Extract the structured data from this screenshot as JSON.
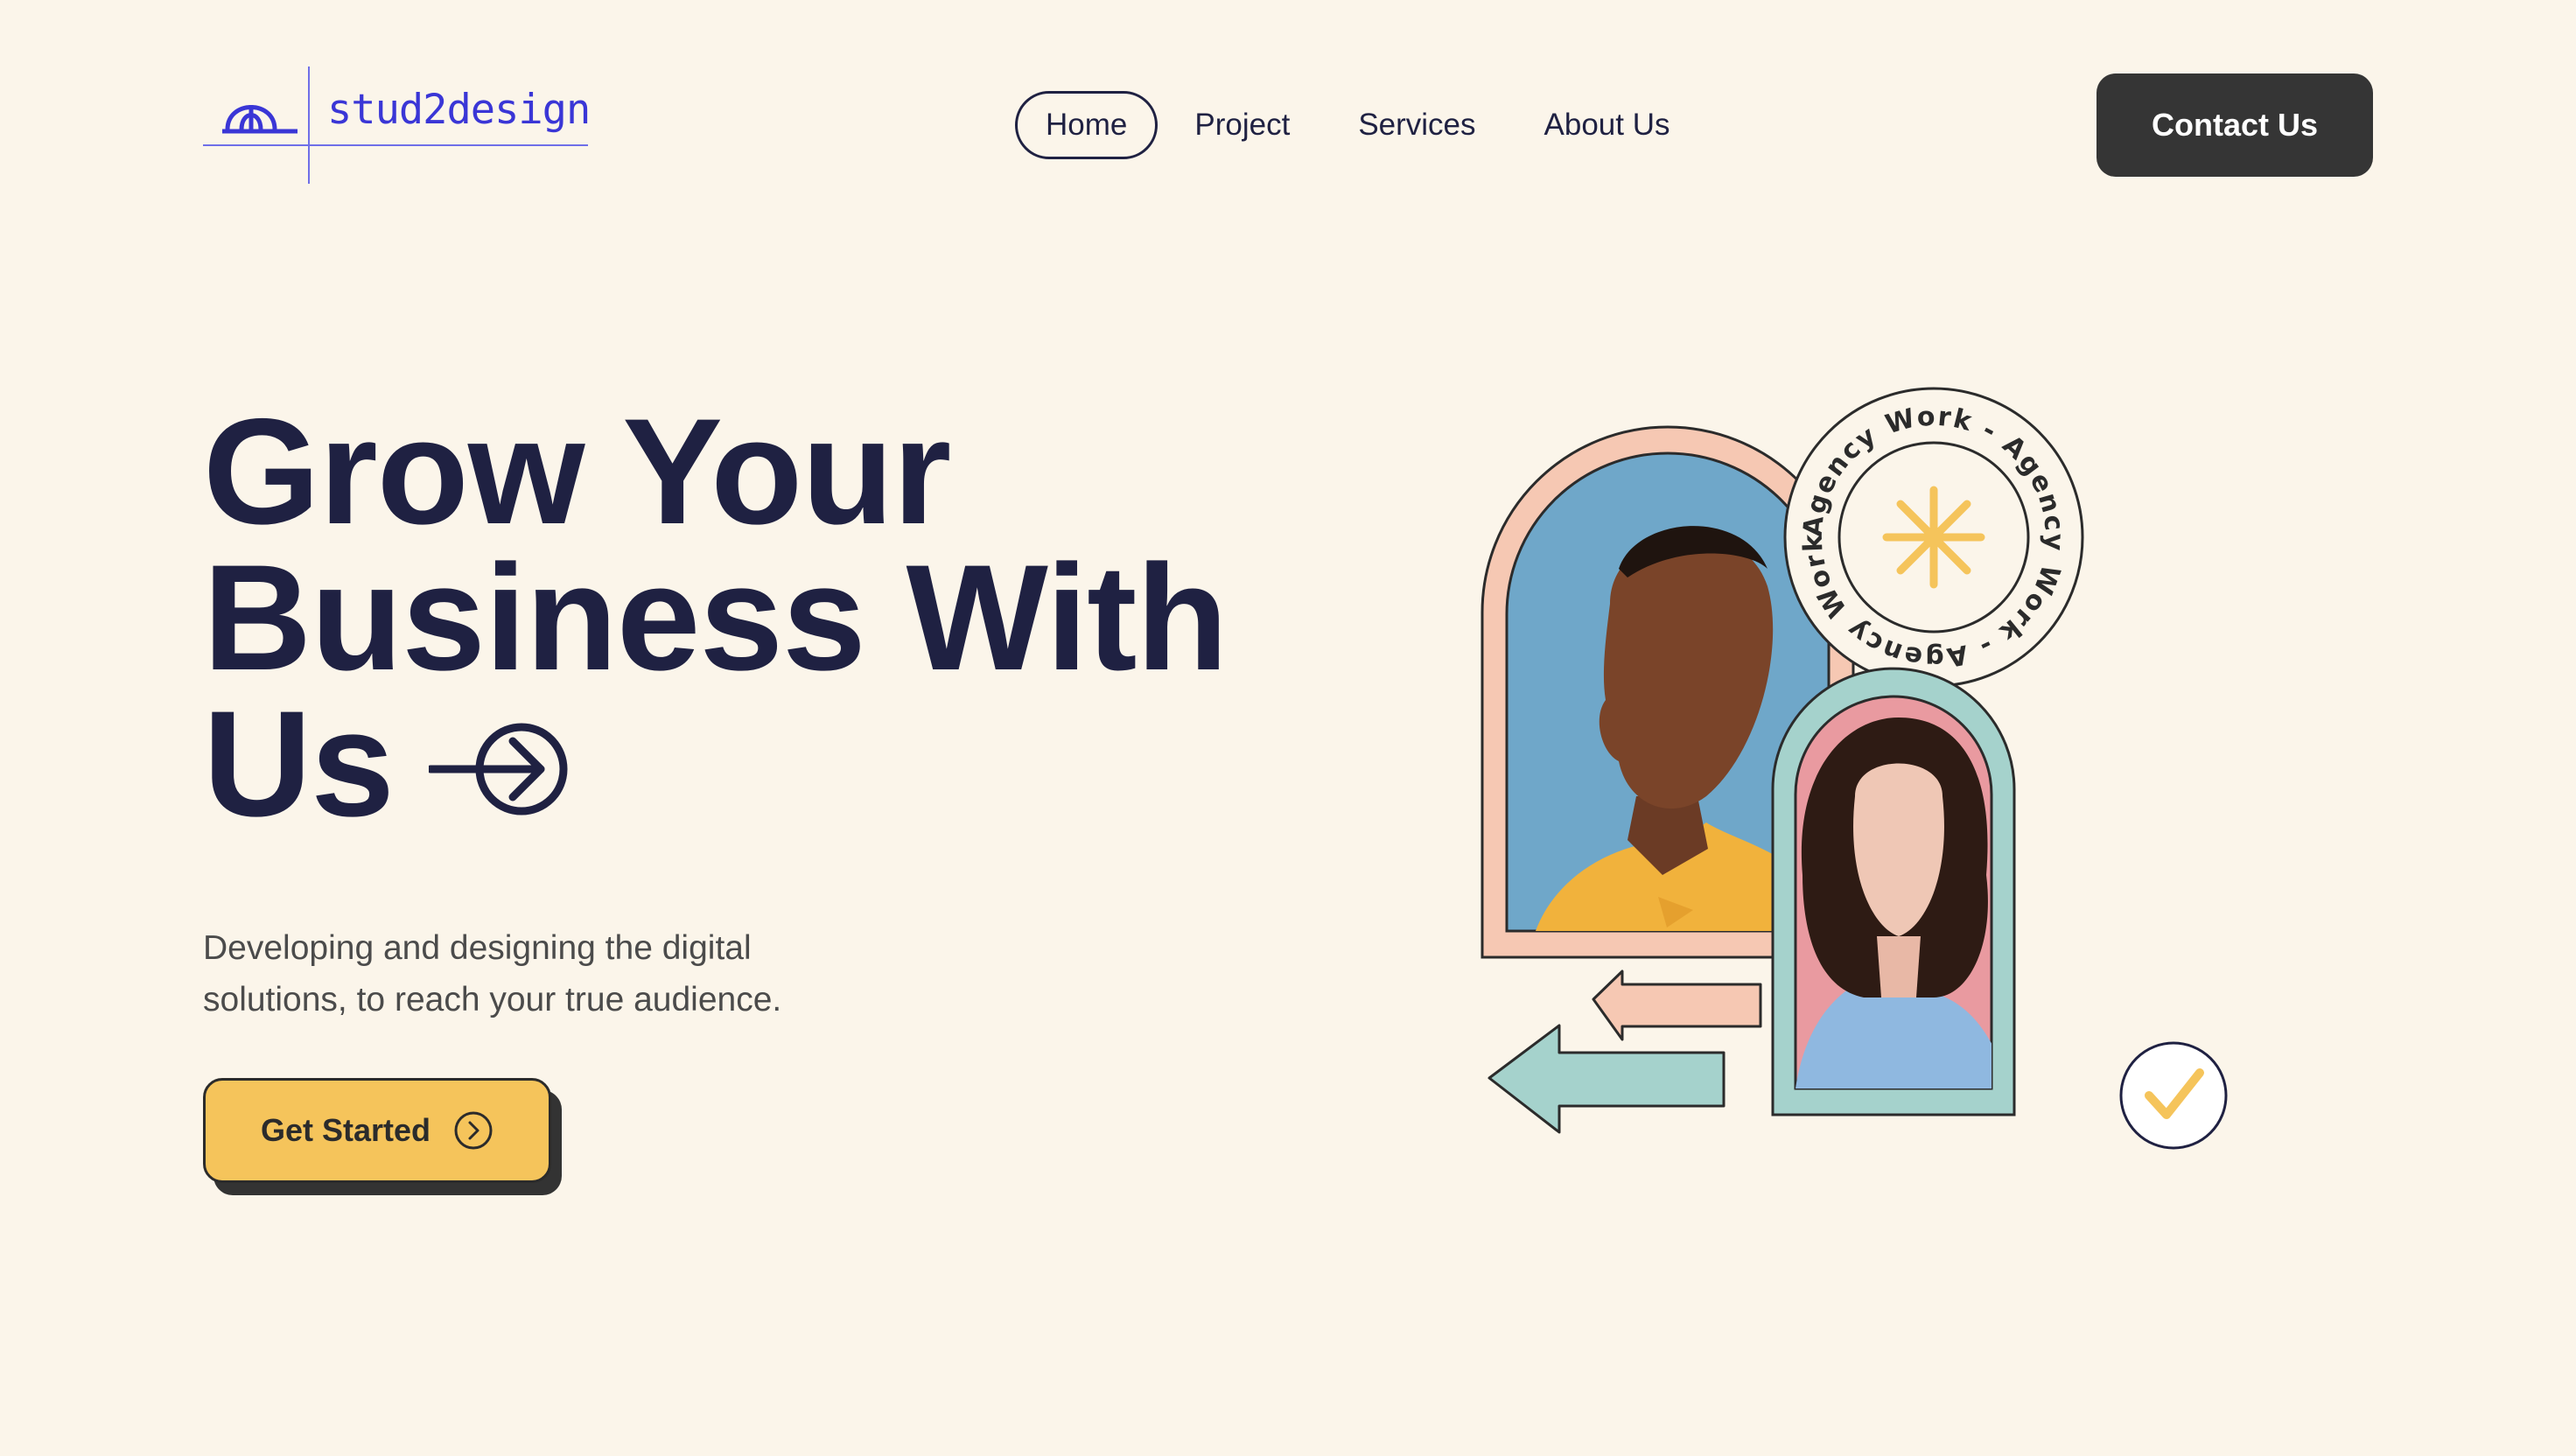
{
  "header": {
    "logo_text": "stud2design",
    "nav": [
      {
        "label": "Home",
        "active": true
      },
      {
        "label": "Project",
        "active": false
      },
      {
        "label": "Services",
        "active": false
      },
      {
        "label": "About Us",
        "active": false
      }
    ],
    "contact_label": "Contact Us"
  },
  "hero": {
    "headline_lines": [
      "Grow Your",
      "Business With",
      "Us"
    ],
    "subtext_lines": [
      "Developing and designing the digital",
      "solutions, to reach your true audience."
    ],
    "cta_label": "Get Started"
  },
  "illustration": {
    "badge_text": "Agency Work - Agency Work - Agency Work - ",
    "colors": {
      "peach": "#f6c8b3",
      "teal": "#a5d2cc",
      "yellow": "#f5c45b",
      "navy": "#1f2142",
      "blue_bg": "#6fa7c9",
      "pink_bg": "#e99aa0"
    }
  },
  "icons": [
    "logo-mark-icon",
    "arrow-circle-right-icon",
    "chevron-right-circle-icon",
    "asterisk-icon",
    "arrow-left-icon",
    "checkmark-icon"
  ]
}
